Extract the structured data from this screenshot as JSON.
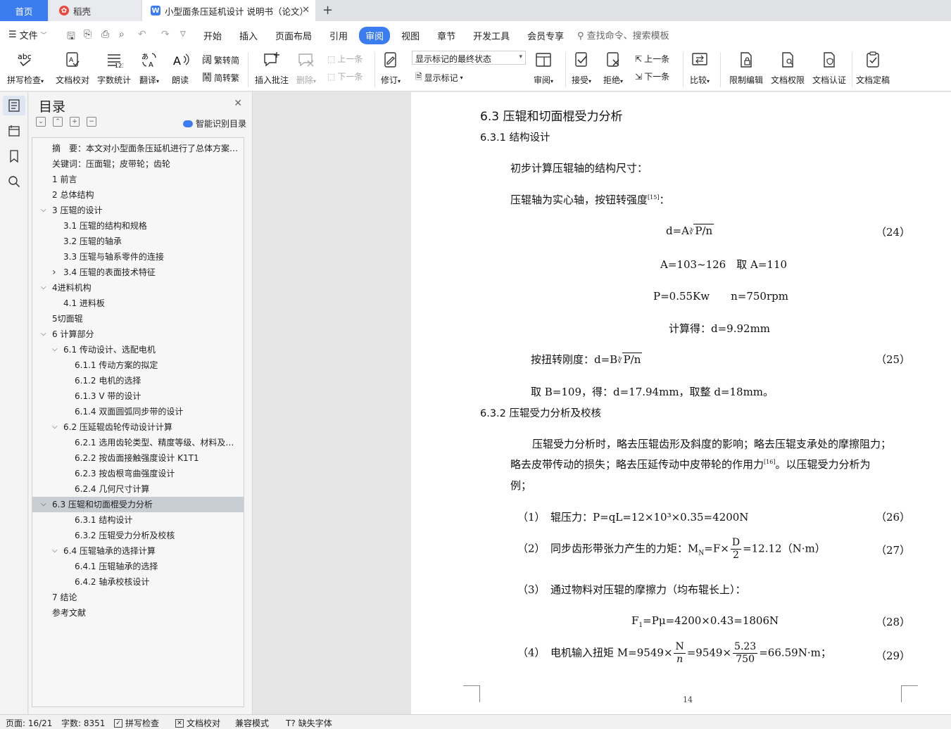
{
  "tabs": {
    "home": "首页",
    "daoke": "稻壳",
    "doc": "小型面条压延机设计 说明书（论文）"
  },
  "menu": {
    "file": "文件",
    "tabs": [
      "开始",
      "插入",
      "页面布局",
      "引用",
      "审阅",
      "视图",
      "章节",
      "开发工具",
      "会员专享"
    ],
    "active_tab": "审阅",
    "search": "查找命令、搜索模板"
  },
  "ribbon": {
    "spell_check": "拼写检查",
    "doc_proof": "文档校对",
    "word_count": "字数统计",
    "translate": "翻译",
    "read_aloud": "朗读",
    "trad_to_simp": "繁转简",
    "simp_to_trad": "简转繁",
    "insert_comment": "插入批注",
    "delete": "删除",
    "prev_comment": "上一条",
    "next_comment": "下一条",
    "revise": "修订",
    "markup_select": "显示标记的最终状态",
    "show_markup": "显示标记",
    "review": "审阅",
    "accept": "接受",
    "reject": "拒绝",
    "prev_change": "上一条",
    "next_change": "下一条",
    "compare": "比较",
    "restrict_edit": "限制编辑",
    "doc_permission": "文档权限",
    "doc_certify": "文档认证",
    "doc_finalize": "文档定稿"
  },
  "toc": {
    "title": "目录",
    "smart_label": "智能识别目录",
    "items": [
      {
        "text": "摘　要：本文对小型面条压延机进行了总体方案…",
        "level": 0,
        "arrow": ""
      },
      {
        "text": "关键词：压面辊；皮带轮；齿轮",
        "level": 0,
        "arrow": ""
      },
      {
        "text": "1  前言",
        "level": 0,
        "arrow": ""
      },
      {
        "text": "2  总体结构",
        "level": 0,
        "arrow": ""
      },
      {
        "text": "3  压辊的设计",
        "level": 0,
        "arrow": "v"
      },
      {
        "text": "3.1  压辊的结构和规格",
        "level": 1,
        "arrow": ""
      },
      {
        "text": "3.2  压辊的轴承",
        "level": 1,
        "arrow": ""
      },
      {
        "text": "3.3  压辊与轴系零件的连接",
        "level": 1,
        "arrow": ""
      },
      {
        "text": "3.4  压辊的表面技术特征",
        "level": 1,
        "arrow": ">"
      },
      {
        "text": "4进料机构",
        "level": 0,
        "arrow": "v"
      },
      {
        "text": "4.1  进料板",
        "level": 1,
        "arrow": ""
      },
      {
        "text": "5切面辊",
        "level": 0,
        "arrow": ""
      },
      {
        "text": "6  计算部分",
        "level": 0,
        "arrow": "v"
      },
      {
        "text": "6.1  传动设计、选配电机",
        "level": 1,
        "arrow": "v"
      },
      {
        "text": "6.1.1 传动方案的拟定",
        "level": 2,
        "arrow": ""
      },
      {
        "text": "6.1.2  电机的选择",
        "level": 2,
        "arrow": ""
      },
      {
        "text": "6.1.3    V 带的设计",
        "level": 2,
        "arrow": ""
      },
      {
        "text": "6.1.4  双面圆弧同步带的设计",
        "level": 2,
        "arrow": ""
      },
      {
        "text": "6.2  压延辊齿轮传动设计计算",
        "level": 1,
        "arrow": "v"
      },
      {
        "text": "6.2.1  选用齿轮类型、精度等级、材料及…",
        "level": 2,
        "arrow": ""
      },
      {
        "text": "6.2.2 按齿面接触强度设计 K1T1",
        "level": 2,
        "arrow": ""
      },
      {
        "text": "6.2.3 按齿根弯曲强度设计",
        "level": 2,
        "arrow": ""
      },
      {
        "text": "6.2.4 几何尺寸计算",
        "level": 2,
        "arrow": ""
      },
      {
        "text": "6.3 压辊和切面棍受力分析",
        "level": 0,
        "arrow": "v",
        "selected": true
      },
      {
        "text": "6.3.1 结构设计",
        "level": 2,
        "arrow": ""
      },
      {
        "text": "6.3.2 压辊受力分析及校核",
        "level": 2,
        "arrow": ""
      },
      {
        "text": "6.4  压辊轴承的选择计算",
        "level": 1,
        "arrow": "v"
      },
      {
        "text": "6.4.1 压辊轴承的选择",
        "level": 2,
        "arrow": ""
      },
      {
        "text": "6.4.2 轴承校核设计",
        "level": 2,
        "arrow": ""
      },
      {
        "text": "7  结论",
        "level": 0,
        "arrow": ""
      },
      {
        "text": "参考文献",
        "level": 0,
        "arrow": ""
      }
    ]
  },
  "doc": {
    "h_63": "6.3 压辊和切面棍受力分析",
    "h_631": "6.3.1 结构设计",
    "p1": "初步计算压辊轴的结构尺寸：",
    "p2": "压辊轴为实心轴，按钮转强度",
    "p2_cite": "[15]",
    "p2_end": "：",
    "eq24_lhs": "d=A",
    "eq24_root": "P/n",
    "eq24_no": "（24）",
    "eq_a": "A=103~126　取 A=110",
    "eq_p": "P=0.55Kw　　n=750rpm",
    "eq_calc": "计算得：d=9.92mm",
    "eq25_lhs": "按扭转刚度：d=B",
    "eq25_root": "P/n",
    "eq25_no": "（25）",
    "eq25_res": "取 B=109，得：d=17.94mm，取整 d=18mm。",
    "h_632": "6.3.2 压辊受力分析及校核",
    "para_1": "压辊受力分析时，略去压辊齿形及斜度的影响；略去压辊支承处的摩擦阻力；",
    "para_2": "略去皮带传动的损失；略去压延传动中皮带轮的作用力",
    "para_cite": "[16]",
    "para_2_end": "。以压辊受力分析为",
    "para_3": "例；",
    "eq26": "（1）　辊压力：P=qL=12×10³×0.35=4200N",
    "eq26_no": "（26）",
    "eq27_pre": "（2）　同步齿形带张力产生的力矩：M",
    "eq27_sub": "N",
    "eq27_mid": "=F×",
    "eq27_num": "D",
    "eq27_den": "2",
    "eq27_post": "=12.12（N·m）",
    "eq27_no": "（27）",
    "eq_3": "（3）　通过物料对压辊的摩擦力（均布辊长上）：",
    "eq28_pre": "F",
    "eq28_sub": "1",
    "eq28_post": "=Pμ=4200×0.43=1806N",
    "eq28_no": "（28）",
    "eq29_pre": "（4）　电机输入扭矩 M=9549×",
    "eq29_n1": "N",
    "eq29_d1": "n",
    "eq29_mid": "=9549×",
    "eq29_n2": "5.23",
    "eq29_d2": "750",
    "eq29_post": "=66.59N·m；",
    "eq29_no": "（29）",
    "page_number": "14"
  },
  "status": {
    "page": "页面: 16/21",
    "words": "字数: 8351",
    "spell": "拼写检查",
    "proof": "文档校对",
    "compat": "兼容模式",
    "missing_font": "缺失字体"
  },
  "colors": {
    "accent": "#3c7cf1",
    "toc_selected": "#c9cdd4"
  }
}
